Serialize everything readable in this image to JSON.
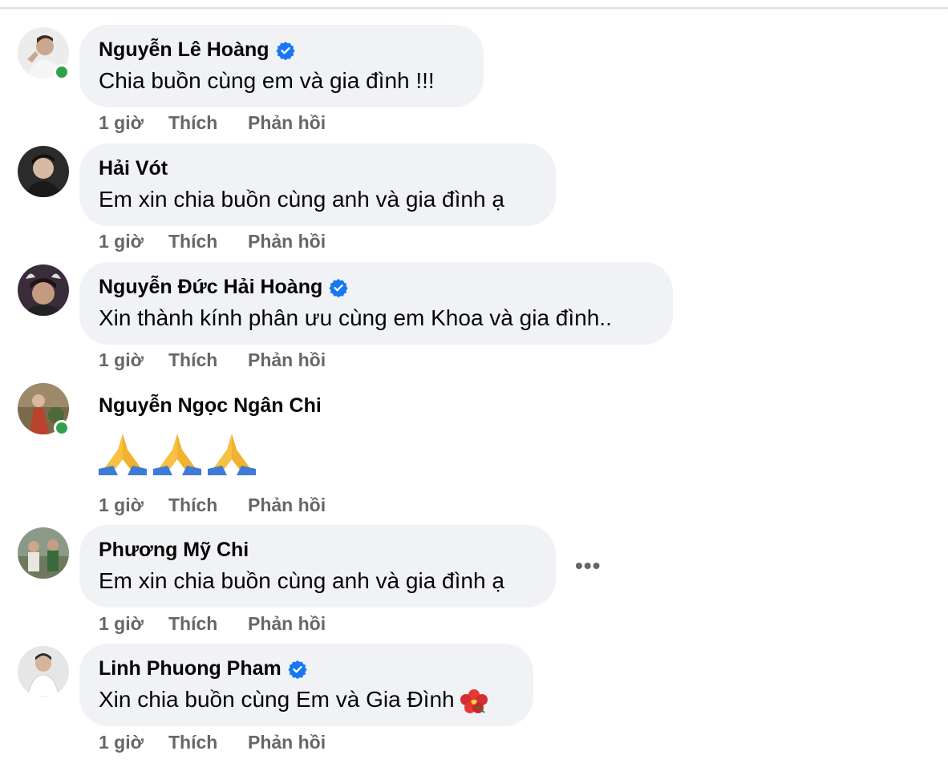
{
  "comments": [
    {
      "author": "Nguyễn Lê Hoàng",
      "verified": true,
      "online": true,
      "text": "Chia buồn cùng em và gia đình !!!",
      "time": "1 giờ",
      "like": "Thích",
      "reply": "Phản hồi"
    },
    {
      "author": "Hải Vót",
      "verified": false,
      "online": false,
      "text": "Em xin chia buồn cùng anh và gia đình ạ",
      "time": "1 giờ",
      "like": "Thích",
      "reply": "Phản hồi"
    },
    {
      "author": "Nguyễn Đức Hải Hoàng",
      "verified": true,
      "online": false,
      "text": "Xin thành kính phân ưu cùng em Khoa và gia đình..",
      "time": "1 giờ",
      "like": "Thích",
      "reply": "Phản hồi"
    },
    {
      "author": "Nguyễn Ngọc Ngân Chi",
      "verified": false,
      "online": true,
      "emoji": "folded-hands x3",
      "time": "1 giờ",
      "like": "Thích",
      "reply": "Phản hồi"
    },
    {
      "author": "Phương Mỹ Chi",
      "verified": false,
      "online": false,
      "text": "Em xin chia buồn cùng anh và gia đình ạ",
      "more": "•••",
      "time": "1 giờ",
      "like": "Thích",
      "reply": "Phản hồi"
    },
    {
      "author": "Linh Phuong Pham",
      "verified": true,
      "online": false,
      "text": "Xin chia buồn cùng Em và Gia Đình",
      "emoji": "hibiscus",
      "time": "1 giờ",
      "like": "Thích",
      "reply": "Phản hồi"
    }
  ],
  "colors": {
    "bubble": "#f0f2f5",
    "meta": "#65676b",
    "verified": "#1877f2",
    "online": "#31a24c"
  }
}
